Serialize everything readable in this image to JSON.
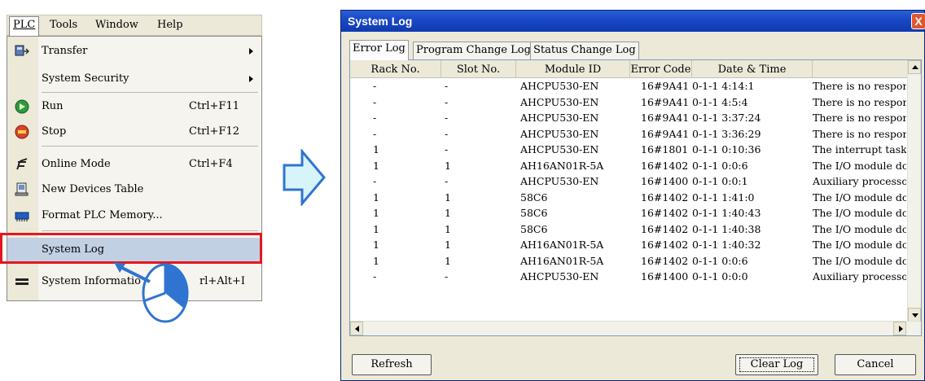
{
  "menubar": {
    "items": [
      {
        "label": "PLC"
      },
      {
        "label": "Tools"
      },
      {
        "label": "Window"
      },
      {
        "label": "Help"
      }
    ]
  },
  "plc_menu": {
    "items": [
      {
        "label": "Transfer",
        "shortcut": "",
        "icon": "transfer-icon",
        "submenu": true
      },
      {
        "label": "System Security",
        "shortcut": "",
        "icon": "",
        "submenu": true
      },
      {
        "label": "Run",
        "shortcut": "Ctrl+F11",
        "icon": "run-icon",
        "submenu": false
      },
      {
        "label": "Stop",
        "shortcut": "Ctrl+F12",
        "icon": "stop-icon",
        "submenu": false
      },
      {
        "label": "Online Mode",
        "shortcut": "Ctrl+F4",
        "icon": "online-mode-icon",
        "submenu": false
      },
      {
        "label": "New Devices Table",
        "shortcut": "",
        "icon": "devices-table-icon",
        "submenu": false
      },
      {
        "label": "Format PLC Memory...",
        "shortcut": "",
        "icon": "format-memory-icon",
        "submenu": false
      },
      {
        "label": "System Log",
        "shortcut": "",
        "icon": "",
        "submenu": false
      },
      {
        "label": "System Informatio",
        "shortcut": "rl+Alt+I",
        "icon": "system-info-icon",
        "submenu": false
      }
    ],
    "highlight_color": "#e3181e"
  },
  "window": {
    "title": "System Log",
    "close_label": "X",
    "tabs": [
      {
        "label": "Error Log",
        "active": true
      },
      {
        "label": "Program Change Log",
        "active": false
      },
      {
        "label": "Status Change Log",
        "active": false
      }
    ],
    "columns": [
      "Rack No.",
      "Slot No.",
      "Module ID",
      "Error Code",
      "Date & Time",
      ""
    ],
    "rows": [
      [
        "-",
        "-",
        "AHCPU530-EN",
        "16#9A41",
        "0-1-1  4:14:1",
        "There is no respor"
      ],
      [
        "-",
        "-",
        "AHCPU530-EN",
        "16#9A41",
        "0-1-1  4:5:4",
        "There is no respor"
      ],
      [
        "-",
        "-",
        "AHCPU530-EN",
        "16#9A41",
        "0-1-1  3:37:24",
        "There is no respor"
      ],
      [
        "-",
        "-",
        "AHCPU530-EN",
        "16#9A41",
        "0-1-1  3:36:29",
        "There is no respor"
      ],
      [
        "1",
        "-",
        "AHCPU530-EN",
        "16#1801",
        "0-1-1  0:10:36",
        "The interrupt task"
      ],
      [
        "1",
        "1",
        "AH16AN01R-5A",
        "16#1402",
        "0-1-1  0:0:6",
        "The I/O module dc"
      ],
      [
        "-",
        "-",
        "AHCPU530-EN",
        "16#1400",
        "0-1-1  0:0:1",
        "Auxiliary processo"
      ],
      [
        "1",
        "1",
        "58C6",
        "16#1402",
        "0-1-1  1:41:0",
        "The I/O module dc"
      ],
      [
        "1",
        "1",
        "58C6",
        "16#1402",
        "0-1-1  1:40:43",
        "The I/O module dc"
      ],
      [
        "1",
        "1",
        "58C6",
        "16#1402",
        "0-1-1  1:40:38",
        "The I/O module dc"
      ],
      [
        "1",
        "1",
        "AH16AN01R-5A",
        "16#1402",
        "0-1-1  1:40:32",
        "The I/O module dc"
      ],
      [
        "1",
        "1",
        "AH16AN01R-5A",
        "16#1402",
        "0-1-1  0:0:6",
        "The I/O module dc"
      ],
      [
        "-",
        "-",
        "AHCPU530-EN",
        "16#1400",
        "0-1-1  0:0:0",
        "Auxiliary processo"
      ]
    ],
    "buttons": {
      "refresh": "Refresh",
      "clear_log": "Clear Log",
      "cancel": "Cancel"
    }
  },
  "colors": {
    "arrow_fill": "#d7f4fb",
    "arrow_stroke": "#2f74d0",
    "titlebar": "#1a49c7"
  }
}
